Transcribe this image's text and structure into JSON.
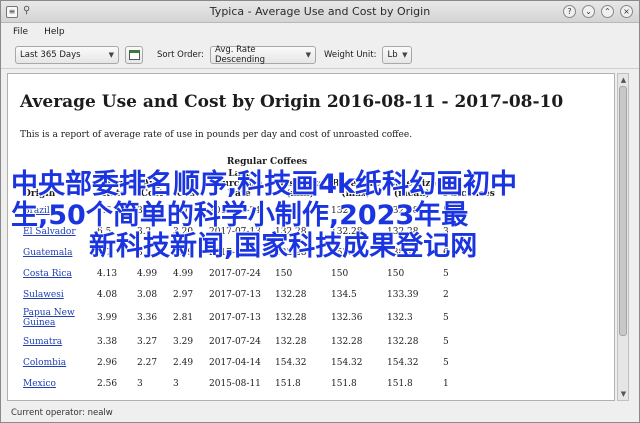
{
  "window": {
    "title": "Typica - Average Use and Cost by Origin"
  },
  "menu": {
    "items": [
      "File",
      "Help"
    ]
  },
  "toolbar": {
    "date_range": "Last 365 Days",
    "sort_order_label": "Sort Order:",
    "sort_order_value": "Avg. Rate Descending",
    "weight_unit_label": "Weight Unit:",
    "weight_unit_value": "Lb"
  },
  "report": {
    "title": "Average Use and Cost by Origin 2016-08-11 - 2017-08-10",
    "description": "This is a report of average rate of use in pounds per day and cost of unroasted coffee.",
    "group_header": "Regular Coffees",
    "columns": [
      "Origin",
      "Avg Rate",
      "Avg Cost",
      "Last Cost",
      "Last Purchase Date",
      "Base Size (min)",
      "Base Size (max)",
      "Base Size (mean)",
      "Purchases"
    ],
    "rows": [
      [
        "Brazil",
        "9.6",
        "3.12",
        "3.0",
        "2017-07-24",
        "131.2",
        "132.3",
        "132.28",
        "5"
      ],
      [
        "El Salvador",
        "6.5",
        "3.2",
        "3.20",
        "2017-07-13",
        "132.28",
        "132.28",
        "132.28",
        "3"
      ],
      [
        "Guatemala",
        "4.7",
        "3.4",
        "3.89",
        "2017-07-24",
        "132.28",
        "152.12",
        "138.12",
        "6"
      ],
      [
        "Costa Rica",
        "4.13",
        "4.99",
        "4.99",
        "2017-07-24",
        "150",
        "150",
        "150",
        "5"
      ],
      [
        "Sulawesi",
        "4.08",
        "3.08",
        "2.97",
        "2017-07-13",
        "132.28",
        "134.5",
        "133.39",
        "2"
      ],
      [
        "Papua New Guinea",
        "3.99",
        "3.36",
        "2.81",
        "2017-07-13",
        "132.28",
        "132.36",
        "132.3",
        "5"
      ],
      [
        "Sumatra",
        "3.38",
        "3.27",
        "3.29",
        "2017-07-24",
        "132.28",
        "132.28",
        "132.28",
        "5"
      ],
      [
        "Colombia",
        "2.96",
        "2.27",
        "2.49",
        "2017-04-14",
        "154.32",
        "154.32",
        "154.32",
        "5"
      ],
      [
        "Mexico",
        "2.56",
        "3",
        "3",
        "2015-08-11",
        "151.8",
        "151.8",
        "151.8",
        "1"
      ]
    ]
  },
  "status": {
    "text": "Current operator: nealw"
  },
  "overlay": {
    "line1": "中央部委排名顺序,科技画4k纸科幻画初中",
    "line2": "生,50个简单的科学小制作,2023年最",
    "line3": "新科技新闻,国家科技成果登记网"
  }
}
